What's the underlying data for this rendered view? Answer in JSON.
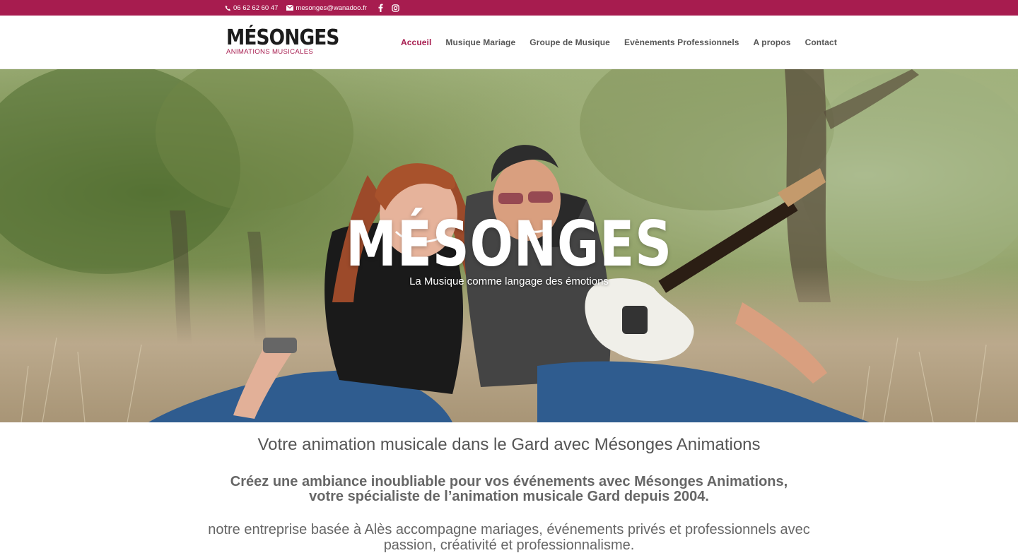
{
  "topbar": {
    "phone": "06 62 62 60 47",
    "email": "mesonges@wanadoo.fr",
    "social": [
      "facebook-icon",
      "instagram-icon"
    ],
    "color": "#a71c4f"
  },
  "logo": {
    "main": "MÉSONGES",
    "sub": "ANIMATIONS MUSICALES"
  },
  "nav": {
    "items": [
      {
        "label": "Accueil",
        "active": true
      },
      {
        "label": "Musique Mariage"
      },
      {
        "label": "Groupe de Musique"
      },
      {
        "label": "Evènements Professionnels"
      },
      {
        "label": "A propos"
      },
      {
        "label": "Contact"
      }
    ]
  },
  "hero": {
    "title": "MÉSONGES",
    "subtitle": "La Musique comme langage des émotions"
  },
  "content": {
    "heading": "Votre animation musicale dans le Gard avec Mésonges Animations",
    "subheading_line1": "Créez une ambiance inoubliable pour vos événements avec Mésonges Animations,",
    "subheading_line2": "votre spécialiste de l’animation musicale Gard depuis 2004.",
    "paragraph_line1": "notre entreprise basée à Alès accompagne mariages, événements privés et professionnels avec",
    "paragraph_line2": "passion, créativité et professionnalisme."
  }
}
